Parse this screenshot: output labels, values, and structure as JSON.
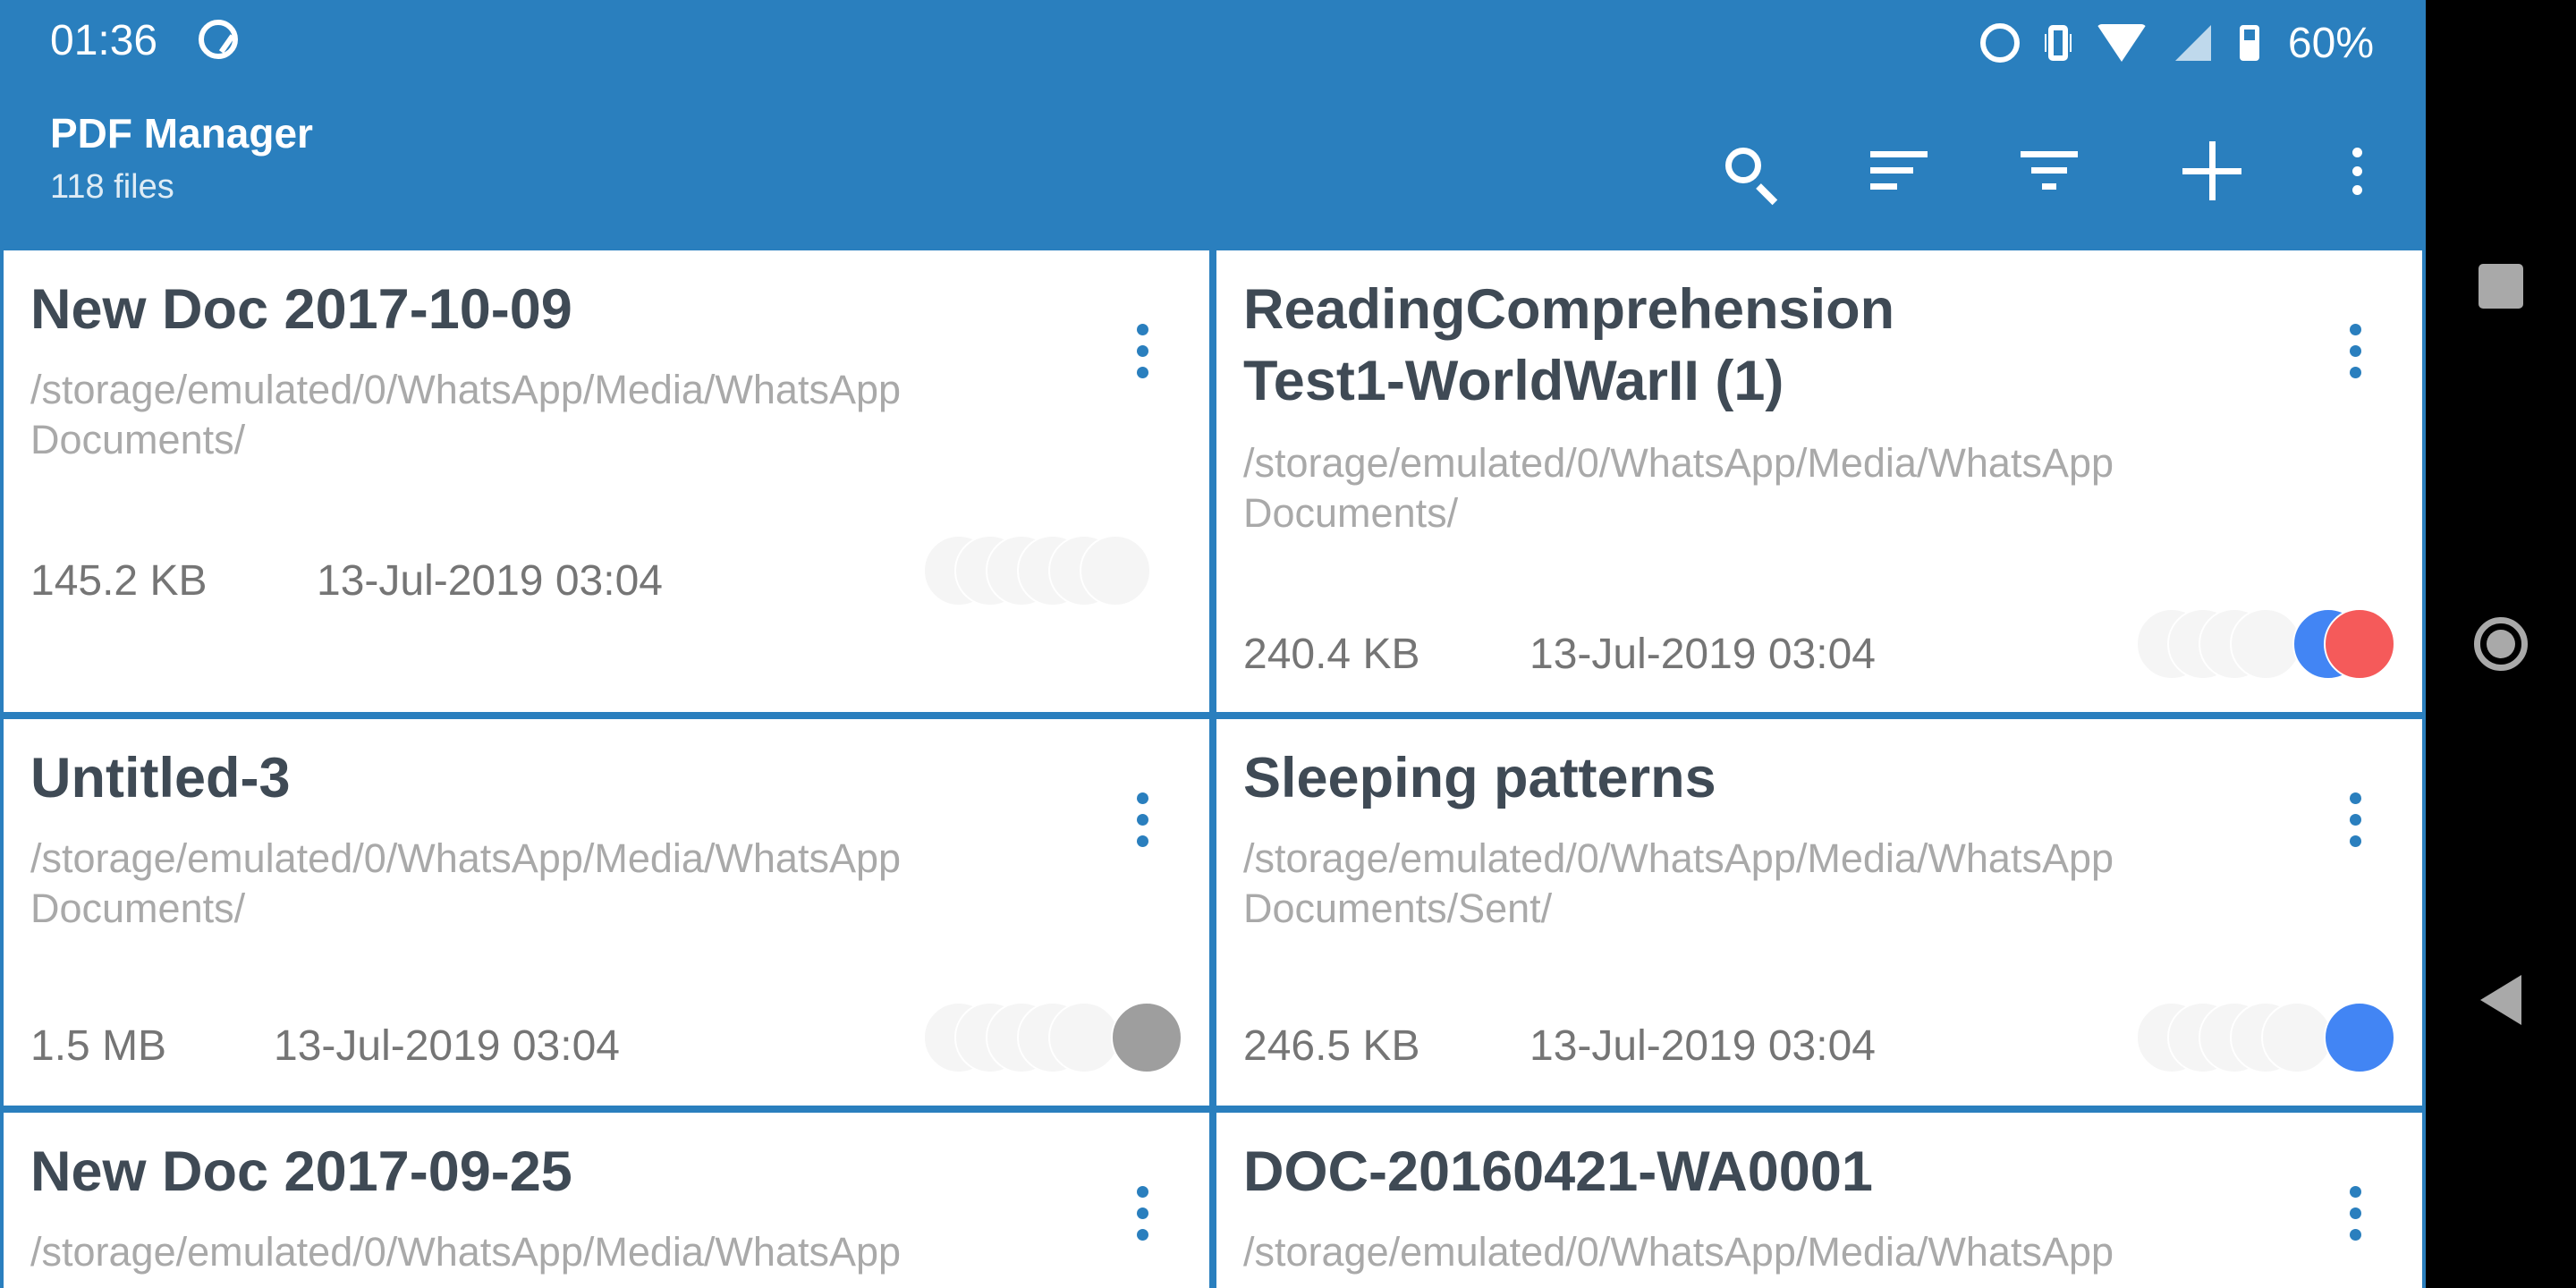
{
  "status_bar": {
    "time": "01:36",
    "battery": "60%"
  },
  "toolbar": {
    "title": "PDF Manager",
    "subtitle": "118 files",
    "actions": [
      "search-icon",
      "sort-icon",
      "filter-icon",
      "add-icon",
      "more-vert-icon"
    ]
  },
  "files": [
    {
      "title": "New Doc 2017-10-09",
      "path": "/storage/emulated/0/WhatsApp/Media/WhatsApp Documents/",
      "size": "145.2 KB",
      "date": "13-Jul-2019 03:04",
      "tags": []
    },
    {
      "title": "ReadingComprehensionTest1-WorldWarII (1)",
      "path": "/storage/emulated/0/WhatsApp/Media/WhatsApp Documents/",
      "size": "240.4 KB",
      "date": "13-Jul-2019 03:04",
      "tags": [
        "#4285f4",
        "#f55a5a"
      ]
    },
    {
      "title": "Untitled-3",
      "path": "/storage/emulated/0/WhatsApp/Media/WhatsApp Documents/",
      "size": "1.5 MB",
      "date": "13-Jul-2019 03:04",
      "tags": [
        "#9e9e9e"
      ]
    },
    {
      "title": "Sleeping patterns",
      "path": "/storage/emulated/0/WhatsApp/Media/WhatsApp Documents/Sent/",
      "size": "246.5 KB",
      "date": "13-Jul-2019 03:04",
      "tags": [
        "#4285f4"
      ]
    },
    {
      "title": "New Doc 2017-09-25",
      "path": "/storage/emulated/0/WhatsApp/Media/WhatsApp",
      "size": "",
      "date": "",
      "tags": []
    },
    {
      "title": "DOC-20160421-WA0001",
      "path": "/storage/emulated/0/WhatsApp/Media/WhatsApp",
      "size": "",
      "date": "",
      "tags": []
    }
  ],
  "colors": {
    "primary": "#2a7fbe",
    "title_text": "#3f4a55",
    "path_text": "#a9a9a9",
    "meta_text": "#757575"
  },
  "nav_bar": [
    "recents-icon",
    "home-icon",
    "back-icon"
  ]
}
